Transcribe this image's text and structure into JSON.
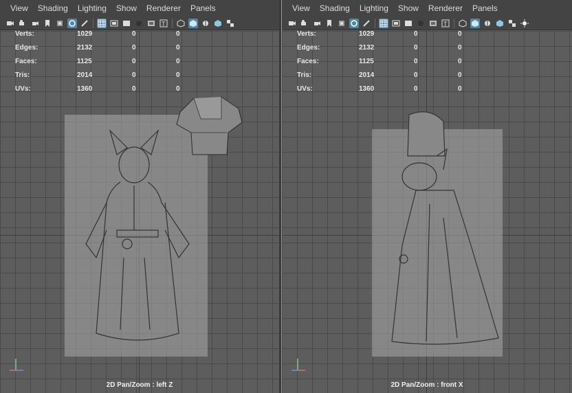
{
  "menus": [
    "View",
    "Shading",
    "Lighting",
    "Show",
    "Renderer",
    "Panels"
  ],
  "toolbar_icons": [
    "select-camera-icon",
    "camera-attributes-icon",
    "bookmark-icon",
    "image-plane-icon",
    "2d-pan-zoom-icon",
    "grease-pencil-icon",
    "grid-icon",
    "film-gate-icon",
    "resolution-gate-icon",
    "gate-mask-icon",
    "field-chart-icon",
    "safe-title-icon",
    "wireframe-icon",
    "smooth-shade-icon",
    "shade-wireframe-icon",
    "xray-icon",
    "textured-icon",
    "lighting-icon"
  ],
  "stats": {
    "labels": [
      "Verts:",
      "Edges:",
      "Faces:",
      "Tris:",
      "UVs:"
    ],
    "rows": [
      [
        "1029",
        "0",
        "0"
      ],
      [
        "2132",
        "0",
        "0"
      ],
      [
        "1125",
        "0",
        "0"
      ],
      [
        "2014",
        "0",
        "0"
      ],
      [
        "1360",
        "0",
        "0"
      ]
    ]
  },
  "left_panel": {
    "camera_label": "2D Pan/Zoom : left Z"
  },
  "right_panel": {
    "camera_label": "2D Pan/Zoom : front X"
  },
  "gizmo": {
    "y": "y",
    "left_axis": "x",
    "right_axis": "z"
  },
  "colors": {
    "active_icon": "#5285a6",
    "viewport_bg": "#5d5d5d",
    "menubar_bg": "#444444"
  }
}
